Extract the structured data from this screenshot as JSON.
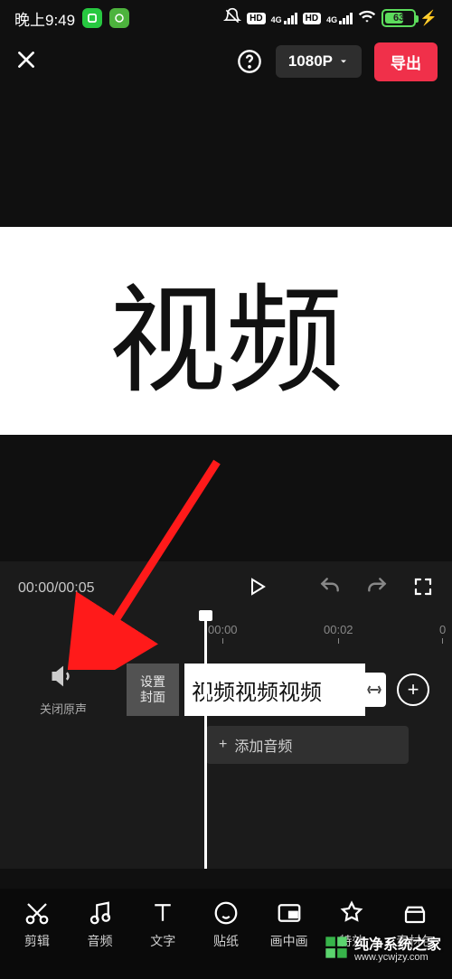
{
  "status": {
    "time": "晚上9:49",
    "battery_pct": "63",
    "net1_label": "4G",
    "net2_label": "4G",
    "hd1": "HD",
    "hd2": "HD"
  },
  "top": {
    "resolution": "1080P",
    "export": "导出"
  },
  "preview": {
    "text": "视频"
  },
  "player": {
    "current": "00:00",
    "total": "00:05"
  },
  "ruler": {
    "t0": "00:00",
    "t1": "00:02",
    "t2": "0"
  },
  "tracks": {
    "mute_label": "关闭原声",
    "cover_label_1": "设置",
    "cover_label_2": "封面",
    "clip_text": "视频视频视频",
    "add_audio": "添加音频",
    "plus": "+"
  },
  "tools": {
    "cut": "剪辑",
    "audio": "音频",
    "text": "文字",
    "sticker": "贴纸",
    "pip": "画中画",
    "fx": "特效",
    "pack": "素材包"
  },
  "watermark": {
    "brand": "纯净系统之家",
    "url": "www.ycwjzy.com"
  }
}
